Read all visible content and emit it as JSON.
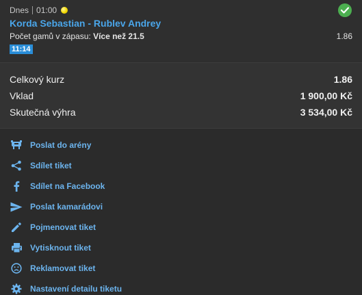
{
  "bet": {
    "day": "Dnes",
    "time": "01:00",
    "match": "Korda Sebastian - Rublev Andrey",
    "market_label": "Počet gamů v zápasu: ",
    "market_pick": "Více než 21.5",
    "odd": "1.86",
    "live_time": "11:14"
  },
  "summary": {
    "total_odds_label": "Celkový kurz",
    "total_odds_value": "1.86",
    "stake_label": "Vklad",
    "stake_value": "1 900,00 Kč",
    "win_label": "Skutečná výhra",
    "win_value": "3 534,00 Kč"
  },
  "actions": [
    {
      "label": "Poslat do arény",
      "icon": "arena-icon"
    },
    {
      "label": "Sdílet tiket",
      "icon": "share-icon"
    },
    {
      "label": "Sdílet na Facebook",
      "icon": "facebook-icon"
    },
    {
      "label": "Poslat kamarádovi",
      "icon": "send-icon"
    },
    {
      "label": "Pojmenovat tiket",
      "icon": "pencil-icon"
    },
    {
      "label": "Vytisknout tiket",
      "icon": "printer-icon"
    },
    {
      "label": "Reklamovat tiket",
      "icon": "sad-face-icon"
    },
    {
      "label": "Nastavení detailu tiketu",
      "icon": "gear-icon"
    }
  ],
  "colors": {
    "link": "#6cb4ee",
    "match": "#4aa6ea",
    "check": "#4caf50",
    "badge": "#2a8ed8"
  }
}
